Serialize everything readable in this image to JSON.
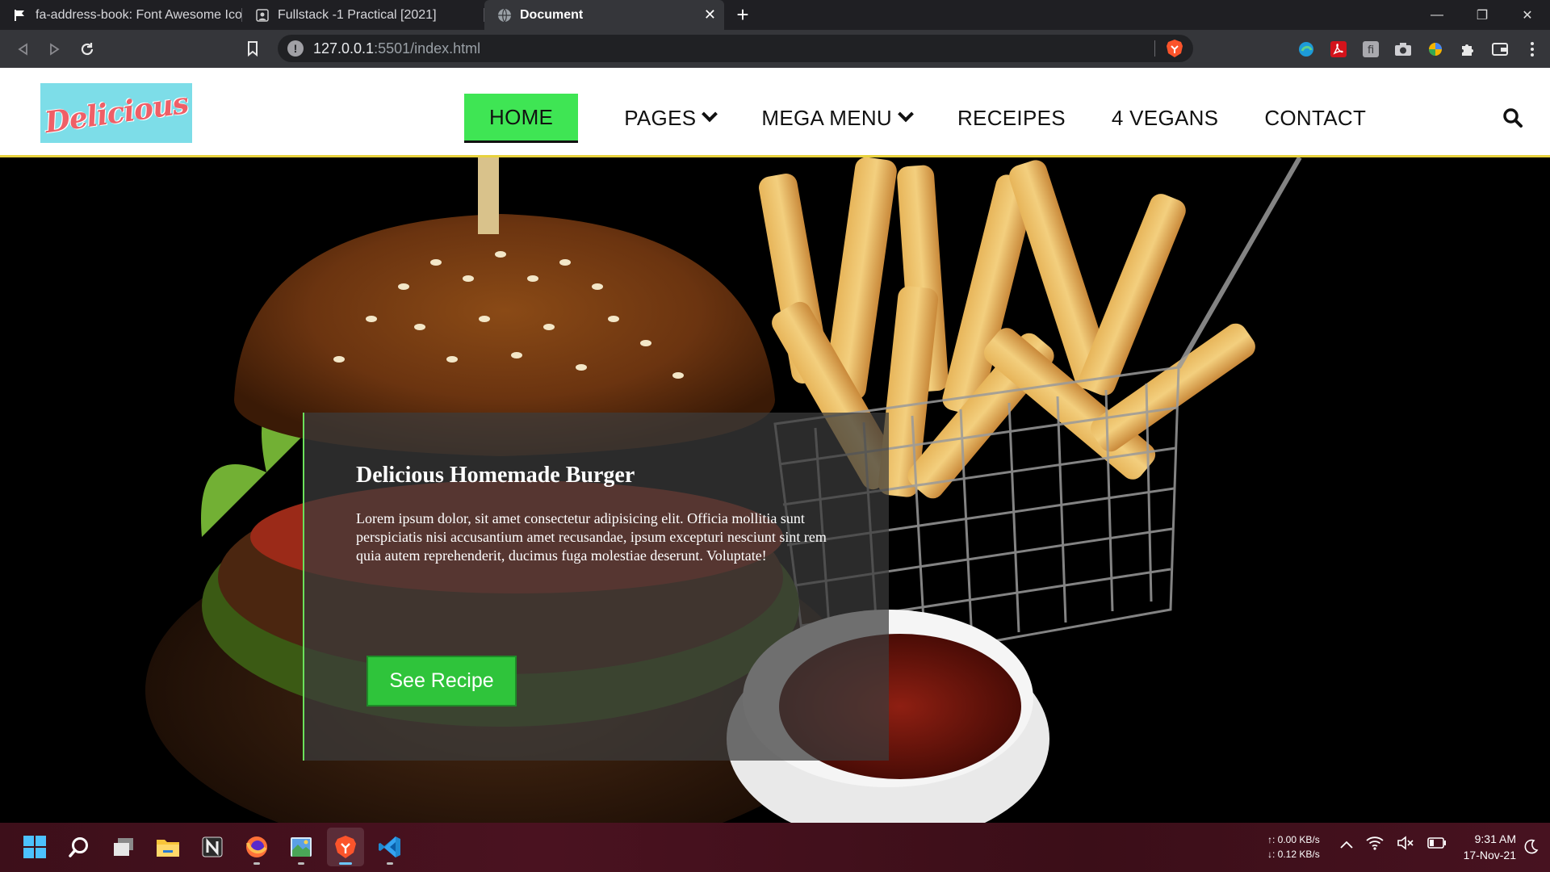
{
  "browser": {
    "tabs": [
      {
        "title": "fa-address-book: Font Awesome Icons",
        "icon": "flag-icon",
        "active": false
      },
      {
        "title": "Fullstack -1 Practical [2021]",
        "icon": "classroom-icon",
        "active": false
      },
      {
        "title": "Document",
        "icon": "globe-icon",
        "active": true
      }
    ],
    "close_glyph": "✕",
    "new_tab_glyph": "+",
    "window_controls": {
      "minimize": "—",
      "maximize": "❐",
      "close": "✕"
    },
    "url_host": "127.0.0.1",
    "url_rest": ":5501/index.html",
    "info_glyph": "!"
  },
  "site": {
    "logo_text": "Delicious",
    "nav": [
      {
        "label": "HOME",
        "active": true,
        "dropdown": false
      },
      {
        "label": "PAGES",
        "active": false,
        "dropdown": true
      },
      {
        "label": "MEGA MENU",
        "active": false,
        "dropdown": true
      },
      {
        "label": "RECEIPES",
        "active": false,
        "dropdown": false
      },
      {
        "label": "4 VEGANS",
        "active": false,
        "dropdown": false
      },
      {
        "label": "CONTACT",
        "active": false,
        "dropdown": false
      }
    ],
    "accent_green": "#3fe554",
    "header_border": "#e8d23e"
  },
  "hero": {
    "title": "Delicious Homemade Burger",
    "body": "Lorem ipsum dolor, sit amet consectetur adipisicing elit. Officia mollitia sunt perspiciatis nisi accusantium amet recusandae, ipsum excepturi nesciunt sint rem quia autem reprehenderit, ducimus fuga molestiae deserunt. Voluptate!",
    "button_label": "See Recipe"
  },
  "taskbar": {
    "apps": [
      "windows-start-icon",
      "search-icon",
      "task-view-icon",
      "file-explorer-icon",
      "notion-icon",
      "firefox-icon",
      "photos-icon",
      "brave-icon",
      "vscode-icon"
    ],
    "upload_speed": "↑: 0.00 KB/s",
    "download_speed": "↓: 0.12 KB/s",
    "time": "9:31 AM",
    "date": "17-Nov-21"
  }
}
